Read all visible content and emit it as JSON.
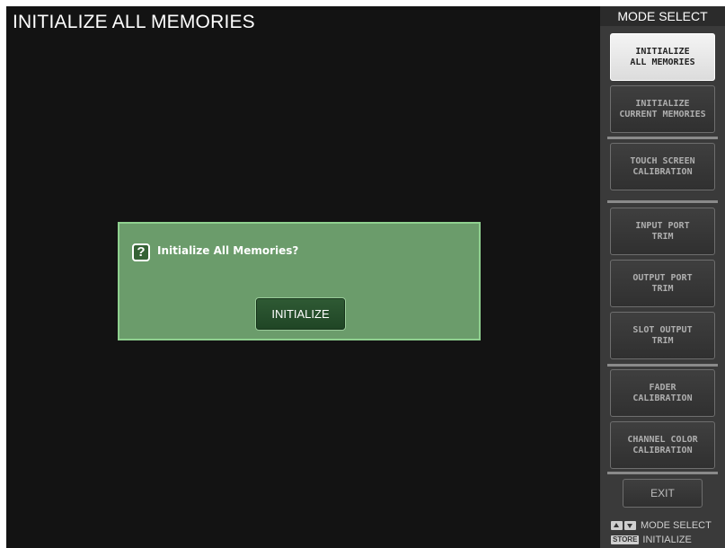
{
  "title": "INITIALIZE ALL MEMORIES",
  "dialog": {
    "icon_glyph": "?",
    "message": "Initialize All Memories?",
    "button_label": "INITIALIZE"
  },
  "sidebar": {
    "header": "MODE SELECT",
    "items": [
      {
        "label": "INITIALIZE\nALL MEMORIES",
        "active": true
      },
      {
        "label": "INITIALIZE\nCURRENT MEMORIES",
        "active": false
      },
      {
        "label": "TOUCH SCREEN\nCALIBRATION",
        "active": false
      },
      {
        "label": "INPUT PORT\nTRIM",
        "active": false
      },
      {
        "label": "OUTPUT PORT\nTRIM",
        "active": false
      },
      {
        "label": "SLOT OUTPUT\nTRIM",
        "active": false
      },
      {
        "label": "FADER\nCALIBRATION",
        "active": false
      },
      {
        "label": "CHANNEL COLOR\nCALIBRATION",
        "active": false
      }
    ],
    "exit_label": "EXIT",
    "legend": {
      "arrows_text": "MODE SELECT",
      "store_key": "STORE",
      "store_text": "INITIALIZE"
    }
  },
  "colors": {
    "dialog_bg": "#6b9c6b",
    "dialog_border": "#8fd08f",
    "button_bg": "#2f5a34",
    "active_item_bg": "#eeeeee"
  }
}
